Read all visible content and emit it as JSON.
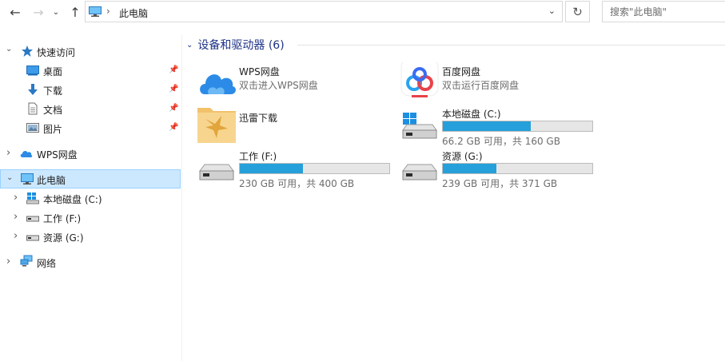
{
  "address": {
    "crumb": "此电脑",
    "separator": "›",
    "dropdown": "⌄",
    "refresh": "↻",
    "back": "←",
    "forward": "→",
    "recent": "⌄",
    "up": "↑"
  },
  "search": {
    "placeholder": "搜索\"此电脑\""
  },
  "sidebar": {
    "quick_access": {
      "label": "快速访问",
      "chevron": "⌄"
    },
    "quick_items": [
      {
        "label": "桌面",
        "icon": "desktop-icon"
      },
      {
        "label": "下载",
        "icon": "download-icon"
      },
      {
        "label": "文档",
        "icon": "document-icon"
      },
      {
        "label": "图片",
        "icon": "picture-icon"
      }
    ],
    "wps": {
      "label": "WPS网盘",
      "chevron": "›"
    },
    "this_pc": {
      "label": "此电脑",
      "chevron": "⌄"
    },
    "drives": [
      {
        "label": "本地磁盘 (C:)",
        "chevron": "›"
      },
      {
        "label": "工作 (F:)",
        "chevron": "›"
      },
      {
        "label": "资源 (G:)",
        "chevron": "›"
      }
    ],
    "network": {
      "label": "网络",
      "chevron": "›"
    },
    "pin": "📌"
  },
  "main": {
    "group_title": "设备和驱动器 (6)",
    "group_chevron": "⌄",
    "apps": [
      {
        "name": "WPS网盘",
        "sub": "双击进入WPS网盘",
        "icon": "wps-cloud-icon"
      },
      {
        "name": "百度网盘",
        "sub": "双击运行百度网盘",
        "icon": "baidu-netdisk-icon"
      },
      {
        "name": "迅雷下载",
        "icon": "xunlei-folder-icon"
      }
    ],
    "drives": [
      {
        "name": "本地磁盘 (C:)",
        "size": "66.2 GB 可用，共 160 GB",
        "used_fraction": 0.586,
        "icon": "windows-drive-icon"
      },
      {
        "name": "工作 (F:)",
        "size": "230 GB 可用，共 400 GB",
        "used_fraction": 0.425,
        "icon": "hard-drive-icon"
      },
      {
        "name": "资源 (G:)",
        "size": "239 GB 可用，共 371 GB",
        "used_fraction": 0.356,
        "icon": "hard-drive-icon"
      }
    ]
  },
  "colors": {
    "accent": "#26a0da",
    "selection": "#cce8ff",
    "group_title": "#1e3287"
  }
}
